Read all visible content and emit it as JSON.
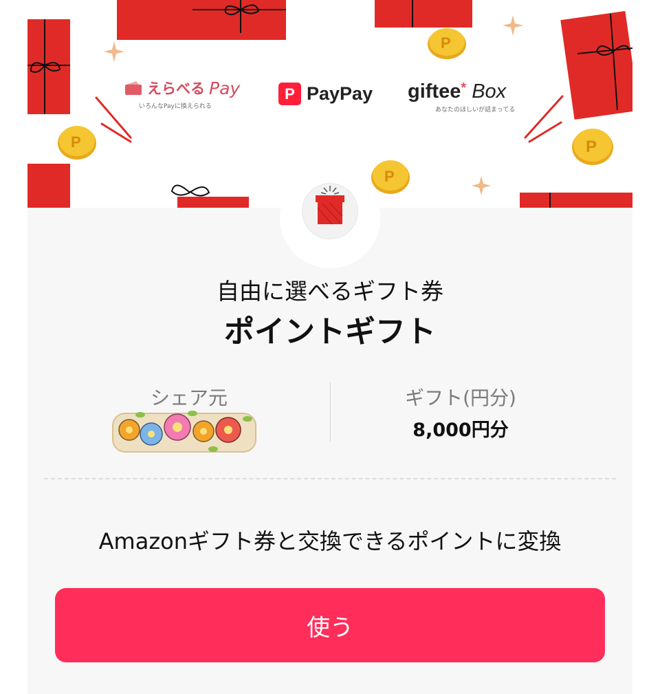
{
  "banner": {
    "partners": [
      {
        "name_jp": "えらべる",
        "name_en": "Pay",
        "tagline": "いろんなPayに換えられる"
      },
      {
        "mark": "P",
        "name": "PayPay"
      },
      {
        "name": "giftee",
        "mark": "*",
        "suffix": "Box",
        "tagline": "あなたのほしいが詰まってる"
      }
    ],
    "icon": "gift-box-icon"
  },
  "gift": {
    "subtitle": "自由に選べるギフト券",
    "title": "ポイントギフト"
  },
  "info": {
    "sharer_label": "シェア元",
    "gift_label": "ギフト(円分)",
    "gift_value": "8,000円分"
  },
  "description": "Amazonギフト券と交換できるポイントに変換",
  "actions": {
    "use_label": "使う"
  },
  "colors": {
    "accent": "#ff2d5a",
    "gift_red": "#e02a27",
    "coin": "#f2c230"
  }
}
